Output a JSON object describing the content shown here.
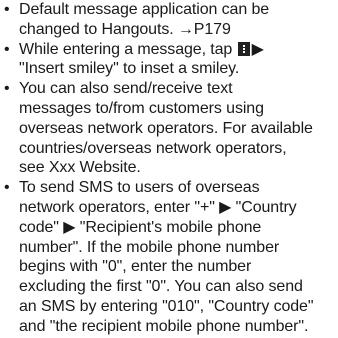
{
  "notes": [
    {
      "bullet": "•",
      "lines": [
        "Default message application can be",
        "changed to Hangouts. →P179"
      ]
    },
    {
      "bullet": "•",
      "line1_before": "While entering a message, tap",
      "line1_after": "▶",
      "icon": "menu-icon",
      "lines": [
        "\"Insert smiley\" to inset a smiley."
      ]
    },
    {
      "bullet": "•",
      "lines": [
        "You can also send/receive text",
        "messages to/from customers using",
        "overseas network operators. For available",
        "countries/overseas network operators,",
        "see Xxx Website."
      ]
    },
    {
      "bullet": "•",
      "lines": [
        "To send SMS to users of overseas",
        "network operators, enter \"+\" ▶ \"Country",
        "code\" ▶ \"Recipient's mobile phone",
        "number\". If the mobile phone number",
        "begins with \"0\", enter the number",
        "excluding the first \"0\". You can also send",
        "an SMS by entering \"010\", \"Country code\"",
        "and \"the recipient mobile phone number\"."
      ]
    }
  ]
}
